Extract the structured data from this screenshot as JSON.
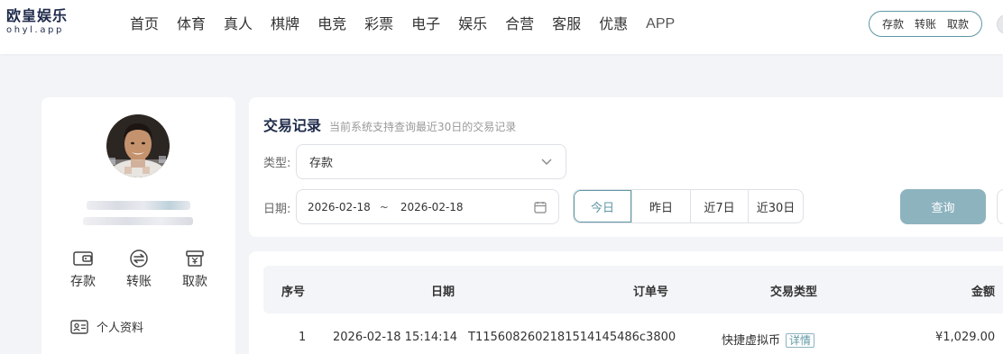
{
  "brand": {
    "name_cn": "欧皇娱乐",
    "domain": "ohyl.app"
  },
  "nav": {
    "items": [
      "首页",
      "体育",
      "真人",
      "棋牌",
      "电竞",
      "彩票",
      "电子",
      "娱乐",
      "合营",
      "客服",
      "优惠",
      "APP"
    ]
  },
  "wallet": {
    "deposit": "存款",
    "transfer": "转账",
    "withdraw": "取款"
  },
  "profile": {
    "actions": [
      {
        "label": "存款",
        "icon": "wallet-icon"
      },
      {
        "label": "转账",
        "icon": "transfer-icon"
      },
      {
        "label": "取款",
        "icon": "withdraw-icon"
      }
    ],
    "menu": [
      {
        "label": "个人资料",
        "icon": "id-card-icon"
      }
    ]
  },
  "filter": {
    "title": "交易记录",
    "subtitle": "当前系统支持查询最近30日的交易记录",
    "type_label": "类型:",
    "type_value": "存款",
    "date_label": "日期:",
    "date_start": "2026-02-18",
    "date_sep": "~",
    "date_end": "2026-02-18",
    "ranges": [
      "今日",
      "昨日",
      "近7日",
      "近30日"
    ],
    "active_range": "今日",
    "query": "查询"
  },
  "table": {
    "columns": [
      "序号",
      "日期",
      "订单号",
      "交易类型",
      "金额"
    ],
    "rows": [
      {
        "index": "1",
        "date": "2026-02-18 15:14:14",
        "order": "T11560826021815141454 86c3800",
        "order_display": "T1156082602181514145486c3800",
        "type": "快捷虚拟币",
        "detail": "详情",
        "amount": "¥1,029.00"
      }
    ]
  },
  "colors": {
    "accent": "#5f97a4",
    "query_button": "#8db3bf",
    "brand_text": "#1e2a4a",
    "page_bg": "#f2f4f7"
  }
}
